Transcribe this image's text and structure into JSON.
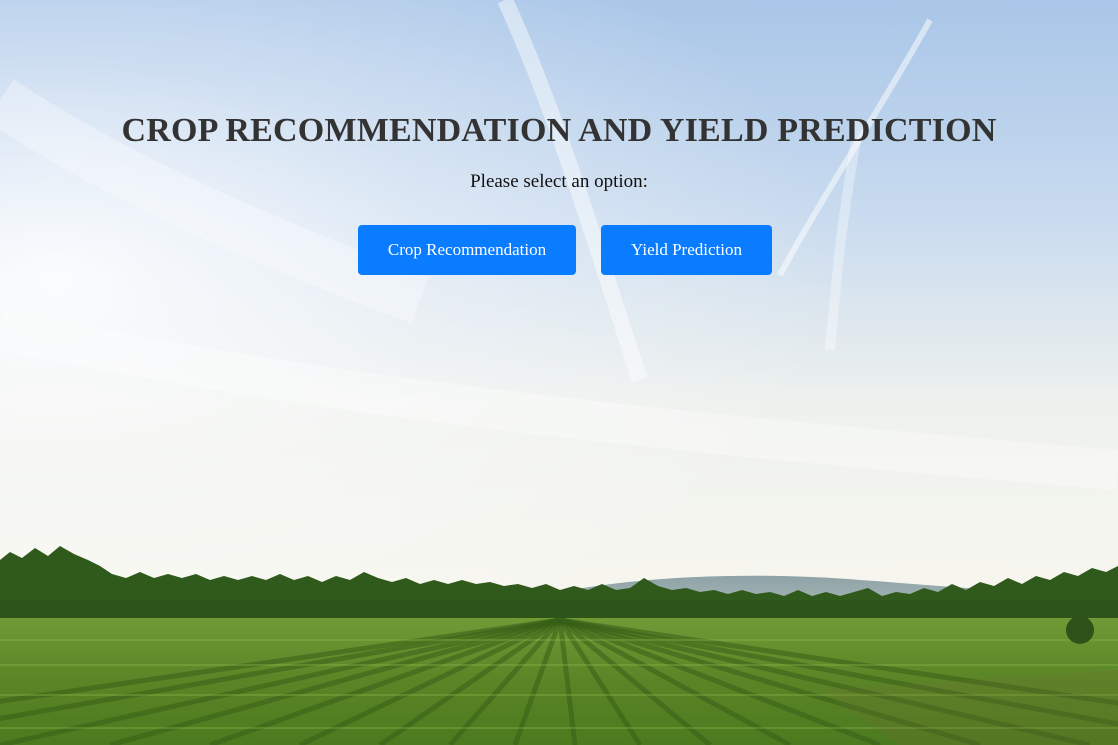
{
  "page": {
    "title": "CROP RECOMMENDATION AND YIELD PREDICTION",
    "subtitle": "Please select an option:"
  },
  "buttons": {
    "crop_recommendation": "Crop Recommendation",
    "yield_prediction": "Yield Prediction"
  },
  "colors": {
    "button_bg": "#0a7cff",
    "title_text": "#333333",
    "sky_top": "#9cbde3",
    "sky_bright": "#f7f8f3",
    "field_green": "#5c8a2a"
  },
  "background": {
    "scene": "farm-field-sky"
  }
}
